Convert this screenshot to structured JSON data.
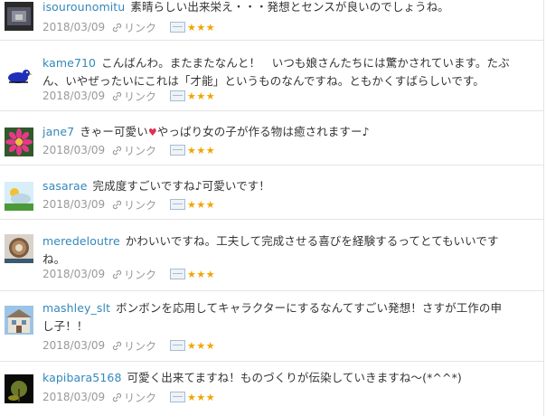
{
  "comments": [
    {
      "user": "isourounomitu",
      "lines": [
        "素晴らしい出来栄え・・・発想とセンスが良いのでしょうね。"
      ],
      "date": "2018/03/09",
      "link_label": "リンク",
      "stars": "★★★",
      "avatar": "avatar-dark-photo"
    },
    {
      "user": "kame710",
      "lines": [
        "こんばんわ。またまたなんと！　いつも娘さんたちには驚かされています。たぶ",
        "ん、いやぜったいにこれは「才能」というものなんですね。ともかくすばらしいです。"
      ],
      "date": "2018/03/09",
      "link_label": "リンク",
      "stars": "★★★",
      "avatar": "avatar-blue-bird"
    },
    {
      "user": "jane7",
      "lines": [
        "きゃー可愛い",
        "やっぱり女の子が作る物は癒されますー♪"
      ],
      "heart": "♥",
      "date": "2018/03/09",
      "link_label": "リンク",
      "stars": "★★★",
      "avatar": "avatar-pink-flower"
    },
    {
      "user": "sasarae",
      "lines": [
        "完成度すごいですね♪可愛いです！"
      ],
      "date": "2018/03/09",
      "link_label": "リンク",
      "stars": "★★★",
      "avatar": "avatar-weather-cloud"
    },
    {
      "user": "meredeloutre",
      "lines": [
        "かわいいですね。工夫して完成させる喜びを経験するってとてもいいです",
        "ね。"
      ],
      "date": "2018/03/09",
      "link_label": "リンク",
      "stars": "★★★",
      "avatar": "avatar-coffee-cup"
    },
    {
      "user": "mashley_slt",
      "lines": [
        "ボンボンを応用してキャラクターにするなんてすごい発想！さすが工作の申",
        "し子！！"
      ],
      "date": "2018/03/09",
      "link_label": "リンク",
      "stars": "★★★",
      "avatar": "avatar-house"
    },
    {
      "user": "kapibara5168",
      "lines": [
        "可愛く出来てますね！ものづくりが伝染していきますね～(*^^*)"
      ],
      "date": "2018/03/09",
      "link_label": "リンク",
      "stars": "★★★",
      "avatar": "avatar-night-tree"
    }
  ]
}
